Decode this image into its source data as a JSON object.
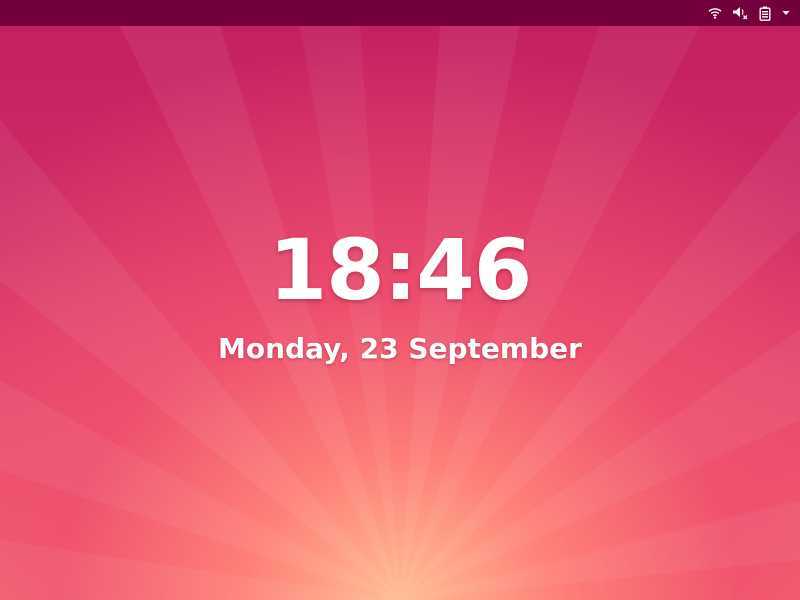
{
  "top_bar": {
    "tray_icons": [
      {
        "name": "wifi-icon"
      },
      {
        "name": "volume-muted-icon"
      },
      {
        "name": "battery-icon"
      },
      {
        "name": "chevron-down-icon"
      }
    ]
  },
  "lock_screen": {
    "time": "18:46",
    "date": "Monday, 23 September"
  },
  "colors": {
    "top_bar_bg": "#73003a",
    "wallpaper_top": "#c31f62",
    "wallpaper_glow": "#ffbe96",
    "text": "#ffffff"
  }
}
